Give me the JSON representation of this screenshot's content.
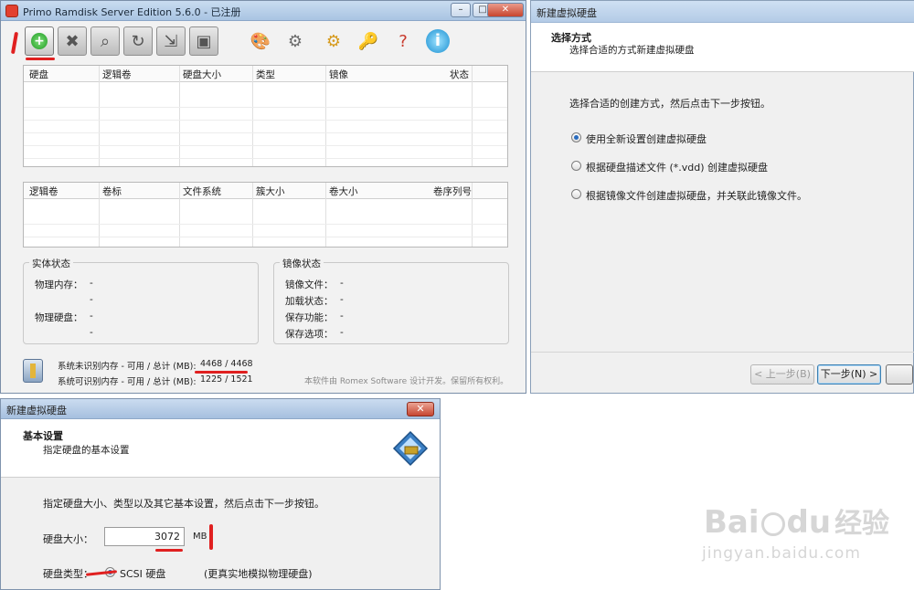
{
  "main_window": {
    "title": "Primo Ramdisk Server Edition 5.6.0 - 已注册",
    "disk_table": {
      "columns": [
        "硬盘",
        "逻辑卷",
        "硬盘大小",
        "类型",
        "镜像",
        "状态"
      ]
    },
    "volume_table": {
      "columns": [
        "逻辑卷",
        "卷标",
        "文件系统",
        "簇大小",
        "卷大小",
        "卷序列号"
      ]
    },
    "physical_status": {
      "title": "实体状态",
      "rows": [
        {
          "label": "物理内存：",
          "value": "-"
        },
        {
          "label": "",
          "value": "-"
        },
        {
          "label": "物理硬盘：",
          "value": "-"
        },
        {
          "label": "",
          "value": "-"
        }
      ]
    },
    "image_status": {
      "title": "镜像状态",
      "rows": [
        {
          "label": "镜像文件：",
          "value": "-"
        },
        {
          "label": "加载状态：",
          "value": "-"
        },
        {
          "label": "保存功能：",
          "value": "-"
        },
        {
          "label": "保存选项：",
          "value": "-"
        }
      ]
    },
    "memory": {
      "unrecognized_label": "系统未识别内存 - 可用 / 总计 (MB):",
      "unrecognized_value": "4468 / 4468",
      "recognized_label": "系统可识别内存 - 可用 / 总计 (MB):",
      "recognized_value": "1225 / 1521"
    },
    "footer_note": "本软件由 Romex Software 设计开发。保留所有权利。"
  },
  "wizard": {
    "title": "新建虚拟硬盘",
    "header_title": "选择方式",
    "header_subtitle": "选择合适的方式新建虚拟硬盘",
    "instruction": "选择合适的创建方式，然后点击下一步按钮。",
    "options": [
      {
        "label": "使用全新设置创建虚拟硬盘",
        "checked": true
      },
      {
        "label": "根据硬盘描述文件 (*.vdd) 创建虚拟硬盘",
        "checked": false
      },
      {
        "label": "根据镜像文件创建虚拟硬盘，并关联此镜像文件。",
        "checked": false
      }
    ],
    "back_button": "< 上一步(B)",
    "next_button": "下一步(N) >"
  },
  "basic": {
    "title": "新建虚拟硬盘",
    "header_title": "基本设置",
    "header_subtitle": "指定硬盘的基本设置",
    "instruction": "指定硬盘大小、类型以及其它基本设置，然后点击下一步按钮。",
    "size_label": "硬盘大小：",
    "size_value": "3072",
    "size_unit": "MB",
    "type_label": "硬盘类型：",
    "type_option": "SCSI 硬盘",
    "type_note": "(更真实地模拟物理硬盘)"
  },
  "watermark": {
    "brand": "Bai",
    "brand2": "du",
    "cn": "经验",
    "url": "jingyan.baidu.com"
  },
  "colors": {
    "annotation_red": "#e02020",
    "title_gradient": "#b3cbe6",
    "radio_dot": "#2a6cbf"
  }
}
